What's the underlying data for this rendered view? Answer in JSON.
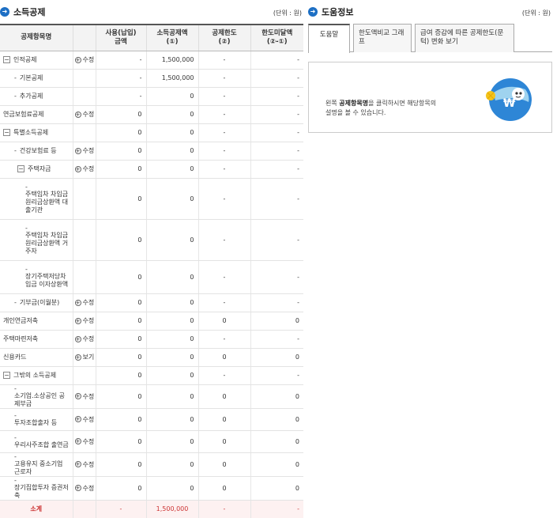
{
  "left": {
    "title": "소득공제",
    "unit": "(단위 : 원)",
    "headers": [
      "공제항목명",
      "사용(납입)\n금액",
      "소득공제액\n(①)",
      "공제한도\n(②)",
      "한도미달액\n(②-①)"
    ],
    "rows": [
      {
        "name": "인적공제",
        "level": 0,
        "toggle": "minus",
        "action": "수정",
        "amount": "-",
        "deduct": "1,500,000",
        "limit": "-",
        "short": "-"
      },
      {
        "name": "기본공제",
        "level": 1,
        "toggle": "dash",
        "action": "",
        "amount": "-",
        "deduct": "1,500,000",
        "limit": "-",
        "short": "-"
      },
      {
        "name": "추가공제",
        "level": 1,
        "toggle": "dash",
        "action": "",
        "amount": "-",
        "deduct": "0",
        "limit": "-",
        "short": "-"
      },
      {
        "name": "연금보험료공제",
        "level": 0,
        "toggle": "none",
        "action": "수정",
        "amount": "0",
        "deduct": "0",
        "limit": "-",
        "short": "-"
      },
      {
        "name": "특별소득공제",
        "level": 0,
        "toggle": "minus",
        "action": "",
        "amount": "0",
        "deduct": "0",
        "limit": "-",
        "short": "-"
      },
      {
        "name": "건강보험료 등",
        "level": 1,
        "toggle": "dash",
        "action": "수정",
        "amount": "0",
        "deduct": "0",
        "limit": "-",
        "short": "-"
      },
      {
        "name": "주택자금",
        "level": 2,
        "toggle": "minus",
        "action": "수정",
        "amount": "0",
        "deduct": "0",
        "limit": "-",
        "short": "-"
      },
      {
        "name": "주택임차 차입금 원리금상환액 대출기관",
        "level": 3,
        "toggle": "dash",
        "action": "",
        "amount": "0",
        "deduct": "0",
        "limit": "-",
        "short": "-",
        "tall": 52
      },
      {
        "name": "주택임차 차입금 원리금상환액 거주자",
        "level": 3,
        "toggle": "dash",
        "action": "",
        "amount": "0",
        "deduct": "0",
        "limit": "-",
        "short": "-",
        "tall": 52
      },
      {
        "name": "장기주택저당차입금 이자상환액",
        "level": 3,
        "toggle": "dash",
        "action": "",
        "amount": "0",
        "deduct": "0",
        "limit": "-",
        "short": "-",
        "tall": 42
      },
      {
        "name": "기부금(이월분)",
        "level": 1,
        "toggle": "dash",
        "action": "수정",
        "amount": "0",
        "deduct": "0",
        "limit": "-",
        "short": "-"
      },
      {
        "name": "개인연금저축",
        "level": 0,
        "toggle": "none",
        "action": "수정",
        "amount": "0",
        "deduct": "0",
        "limit": "0",
        "short": "0"
      },
      {
        "name": "주택마련저축",
        "level": 0,
        "toggle": "none",
        "action": "수정",
        "amount": "0",
        "deduct": "0",
        "limit": "-",
        "short": "-"
      },
      {
        "name": "신용카드",
        "level": 0,
        "toggle": "none",
        "action": "보기",
        "amount": "0",
        "deduct": "0",
        "limit": "0",
        "short": "0"
      },
      {
        "name": "그밖의 소득공제",
        "level": 0,
        "toggle": "minus",
        "action": "",
        "amount": "0",
        "deduct": "0",
        "limit": "-",
        "short": "-"
      },
      {
        "name": "소기업.소상공인 공제부금",
        "level": 1,
        "toggle": "dash",
        "action": "수정",
        "amount": "0",
        "deduct": "0",
        "limit": "0",
        "short": "0",
        "tall": 30
      },
      {
        "name": "투자조합출자 등",
        "level": 1,
        "toggle": "dash",
        "action": "수정",
        "amount": "0",
        "deduct": "0",
        "limit": "0",
        "short": "0",
        "tall": 28
      },
      {
        "name": "우리사주조합 출연금",
        "level": 1,
        "toggle": "dash",
        "action": "수정",
        "amount": "0",
        "deduct": "0",
        "limit": "0",
        "short": "0",
        "tall": 28
      },
      {
        "name": "고용유지 중소기업 근로자",
        "level": 1,
        "toggle": "dash",
        "action": "수정",
        "amount": "0",
        "deduct": "0",
        "limit": "0",
        "short": "0",
        "tall": 28
      },
      {
        "name": "장기집합투자 증권저축",
        "level": 1,
        "toggle": "dash",
        "action": "수정",
        "amount": "0",
        "deduct": "0",
        "limit": "0",
        "short": "0",
        "tall": 28
      }
    ],
    "total": {
      "name": "소계",
      "amount": "-",
      "deduct": "1,500,000",
      "limit": "-",
      "short": "-"
    }
  },
  "right": {
    "title": "도움정보",
    "unit": "(단위 : 원)",
    "tabs": [
      "도움말",
      "한도액비교 그래프",
      "급여 증감에 따른 공제한도(문턱) 변화 보기"
    ],
    "help_line1_prefix": "왼쪽 ",
    "help_line1_bold": "공제항목명",
    "help_line1_suffix": "을 클릭하시면 해당항목의",
    "help_line2": "설명을 볼 수 있습니다.",
    "mascot_symbol": "₩"
  },
  "colors": {
    "accent": "#1d6fc4",
    "total_text": "#cc3333",
    "total_bg": "#fdf1f1",
    "mascot_blue": "#2e86d6",
    "mascot_yellow": "#f3c41c"
  }
}
